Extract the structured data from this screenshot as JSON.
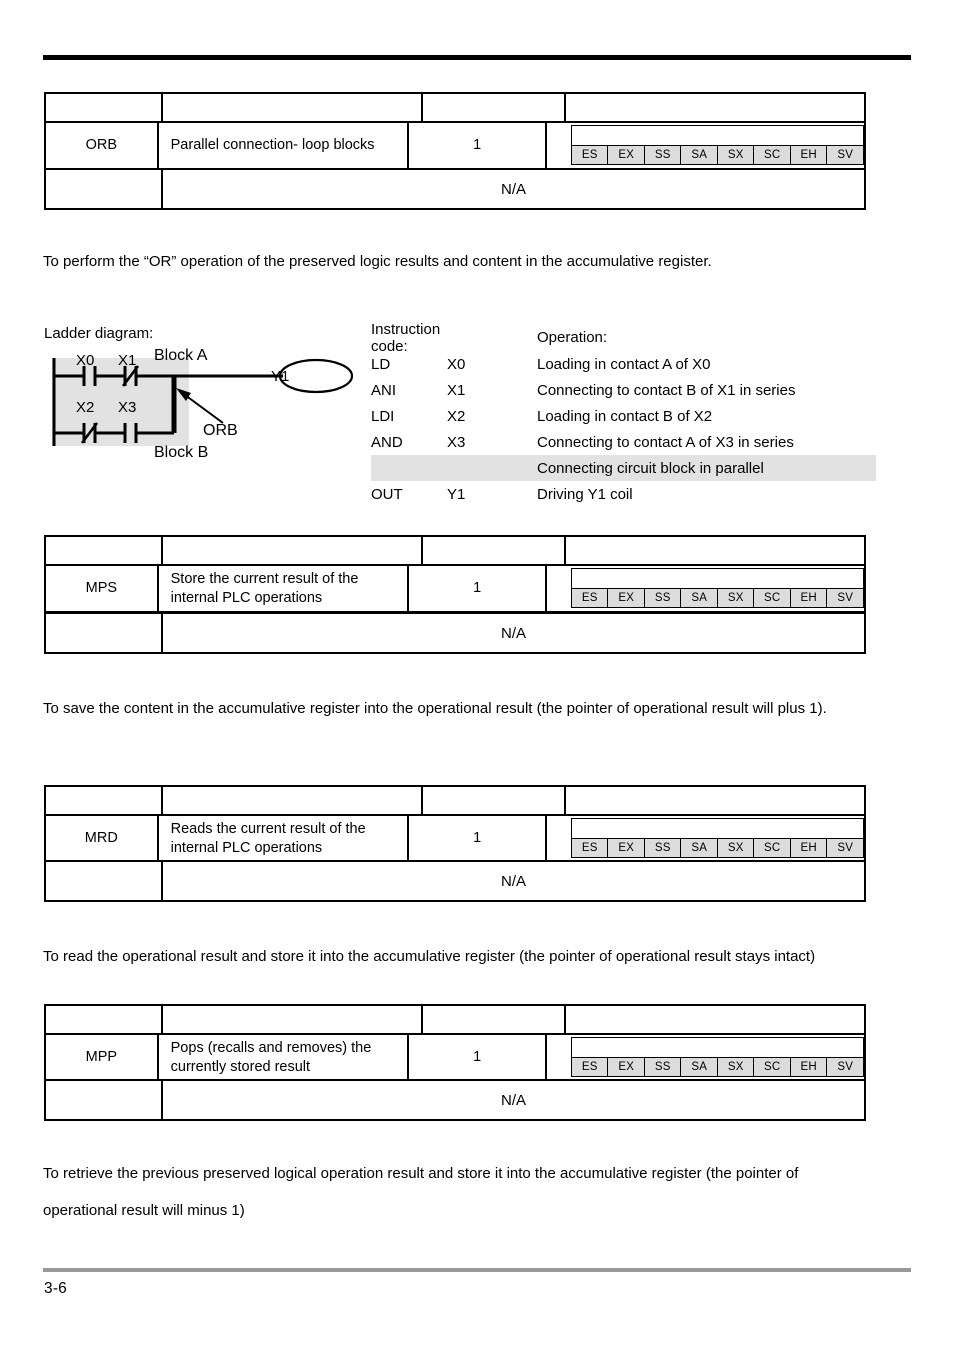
{
  "page": {
    "number": "3-6"
  },
  "model_badges": [
    "ES",
    "EX",
    "SS",
    "SA",
    "SX",
    "SC",
    "EH",
    "SV"
  ],
  "na_label": "N/A",
  "instructions": [
    {
      "mnemonic": "ORB",
      "description": "Parallel connection- loop blocks",
      "steps": "1",
      "paragraph": "To perform the “OR” operation of the preserved logic results and content in the accumulative register."
    },
    {
      "mnemonic": "MPS",
      "description": "Store the current result of the internal PLC operations",
      "steps": "1",
      "paragraph": "To save the content in the accumulative register into the operational result (the pointer of operational result will plus 1)."
    },
    {
      "mnemonic": "MRD",
      "description": "Reads the current result of the internal PLC operations",
      "steps": "1",
      "paragraph": "To read the operational result and store it into the accumulative register (the pointer of operational result stays intact)"
    },
    {
      "mnemonic": "MPP",
      "description": "Pops (recalls and removes) the currently stored result",
      "steps": "1",
      "paragraph": "To retrieve the previous preserved logical operation result and store it into the accumulative register (the pointer of operational result will minus 1)"
    }
  ],
  "example": {
    "ladder_caption": "Ladder diagram:",
    "instruction_code_header": "Instruction code:",
    "operation_header": "Operation:",
    "block_a_label": "Block A",
    "block_b_label": "Block B",
    "orb_annotation": "ORB",
    "contacts": {
      "top": [
        {
          "name": "X0",
          "type": "normally-open"
        },
        {
          "name": "X1",
          "type": "normally-closed"
        }
      ],
      "bottom": [
        {
          "name": "X2",
          "type": "normally-closed"
        },
        {
          "name": "X3",
          "type": "normally-open"
        }
      ]
    },
    "coil": "Y1",
    "code_rows": [
      {
        "mnemonic": "LD",
        "operand": "X0",
        "operation": "Loading in contact A of X0",
        "shaded": false
      },
      {
        "mnemonic": "ANI",
        "operand": "X1",
        "operation": "Connecting to contact B of X1 in series",
        "shaded": false
      },
      {
        "mnemonic": "LDI",
        "operand": "X2",
        "operation": "Loading in contact B of X2",
        "shaded": false
      },
      {
        "mnemonic": "AND",
        "operand": "X3",
        "operation": "Connecting to contact A of X3 in series",
        "shaded": false
      },
      {
        "mnemonic": "",
        "operand": "",
        "operation": "Connecting circuit block in parallel",
        "shaded": true
      },
      {
        "mnemonic": "OUT",
        "operand": "Y1",
        "operation": "Driving Y1 coil",
        "shaded": false
      }
    ]
  },
  "colors": {
    "shading": "#e2e2e2",
    "badge_fill": "#dcdcdc",
    "rule_footer": "#999999",
    "ink": "#000000"
  }
}
